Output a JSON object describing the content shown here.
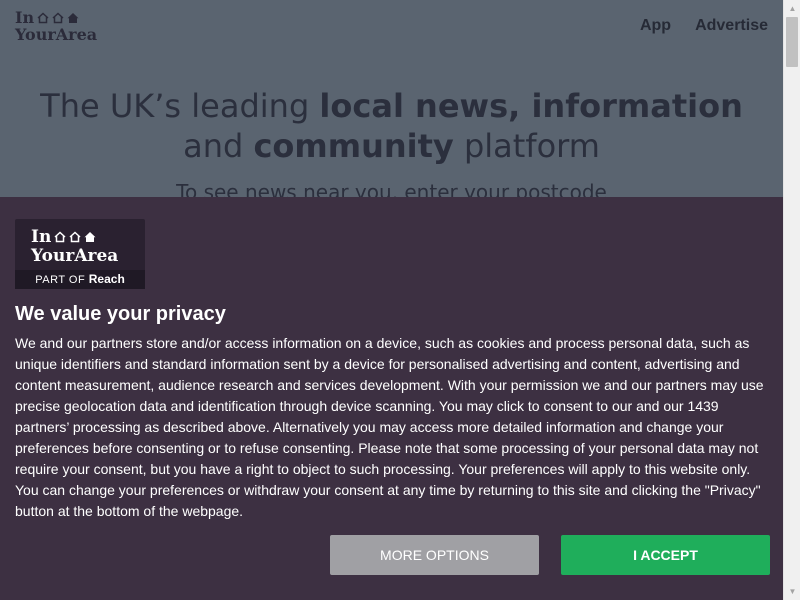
{
  "site": {
    "logo_line1": "In",
    "logo_line2": "YourArea",
    "nav": [
      "App",
      "Advertise"
    ],
    "hero_pre": "The UK’s leading ",
    "hero_bold1": "local news, information",
    "hero_mid": "and ",
    "hero_bold2": "community",
    "hero_post": " platform",
    "hero_sub": "To see news near you, enter your postcode"
  },
  "consent": {
    "logo_line1": "In",
    "logo_line2": "YourArea",
    "logo_partof": "PART OF",
    "logo_reach": "Reach",
    "title": "We value your privacy",
    "body": "We and our partners store and/or access information on a device, such as cookies and process personal data, such as unique identifiers and standard information sent by a device for personalised advertising and content, advertising and content measurement, audience research and services development. With your permission we and our partners may use precise geolocation data and identification through device scanning. You may click to consent to our and our 1439 partners’ processing as described above. Alternatively you may access more detailed information and change your preferences before consenting or to refuse consenting. Please note that some processing of your personal data may not require your consent, but you have a right to object to such processing. Your preferences will apply to this website only. You can change your preferences or withdraw your consent at any time by returning to this site and clicking the \"Privacy\" button at the bottom of the webpage.",
    "more_options_label": "MORE OPTIONS",
    "accept_label": "I ACCEPT"
  },
  "colors": {
    "consent_bg": "#3d3042",
    "accept": "#1fae5b",
    "more_options": "#a0a0a4",
    "site_overlay": "#5a6470"
  },
  "icons": [
    "house-outline-icon",
    "house-outline-icon",
    "house-filled-icon",
    "scroll-up-arrow-icon",
    "scroll-down-arrow-icon"
  ]
}
